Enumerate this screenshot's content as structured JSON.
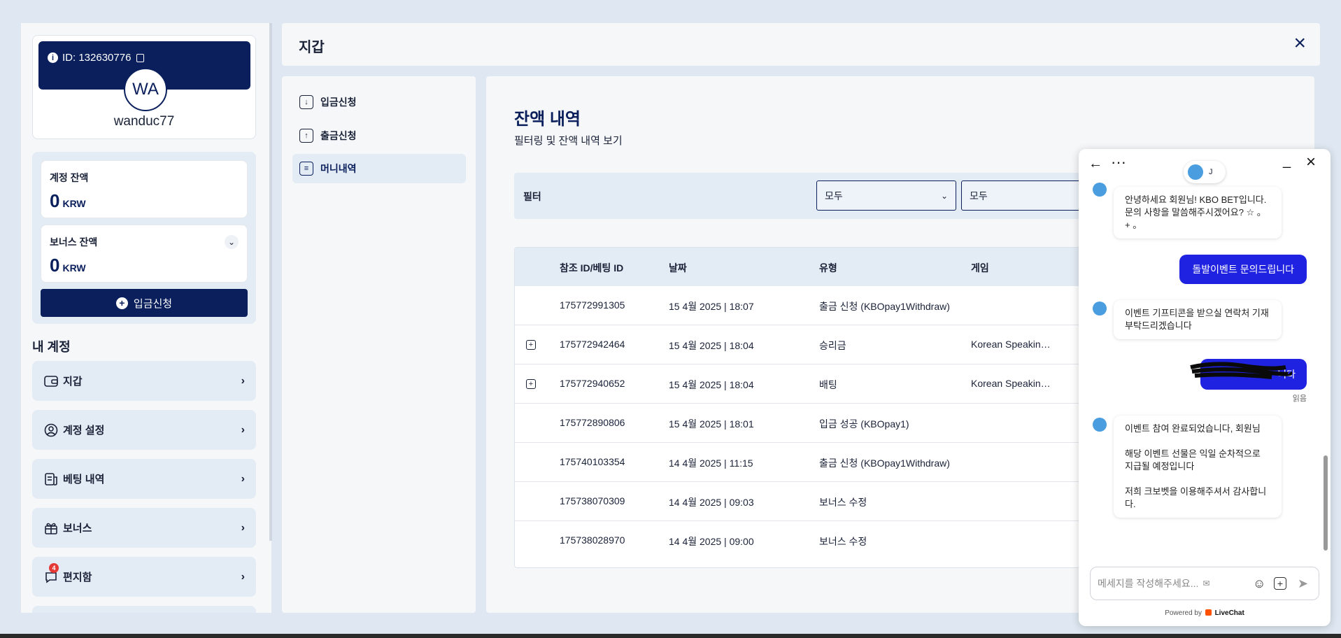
{
  "profile": {
    "id_label": "ID: 132630776",
    "avatar_initials": "WA",
    "username": "wanduc77"
  },
  "balances": {
    "account": {
      "label": "계정 잔액",
      "value": "0",
      "currency": "KRW"
    },
    "bonus": {
      "label": "보너스 잔액",
      "value": "0",
      "currency": "KRW"
    },
    "deposit_button": "입금신청"
  },
  "my_account": {
    "title": "내 계정",
    "items": [
      {
        "label": "지갑",
        "icon": "wallet-icon"
      },
      {
        "label": "계정 설정",
        "icon": "user-icon"
      },
      {
        "label": "베팅 내역",
        "icon": "receipt-icon"
      },
      {
        "label": "보너스",
        "icon": "gift-icon"
      },
      {
        "label": "편지함",
        "icon": "chat-bubble-icon",
        "badge": "4"
      }
    ]
  },
  "wallet": {
    "title": "지갑",
    "menu": [
      {
        "label": "입금신청",
        "icon": "download-icon"
      },
      {
        "label": "출금신청",
        "icon": "upload-icon"
      },
      {
        "label": "머니내역",
        "icon": "document-icon",
        "active": true
      }
    ]
  },
  "history": {
    "title": "잔액 내역",
    "subtitle": "필터링 및 잔액 내역 보기",
    "filter_label": "필터",
    "filter_values": [
      "모두",
      "모두"
    ],
    "columns": [
      "참조 ID/베팅 ID",
      "날짜",
      "유형",
      "게임"
    ],
    "rows": [
      {
        "id": "175772991305",
        "date": "15 4월 2025 | 18:07",
        "type": "출금 신청 (KBOpay1Withdraw)",
        "game": "",
        "expandable": false
      },
      {
        "id": "175772942464",
        "date": "15 4월 2025 | 18:04",
        "type": "승리금",
        "game": "Korean Speakin…",
        "expandable": true
      },
      {
        "id": "175772940652",
        "date": "15 4월 2025 | 18:04",
        "type": "배팅",
        "game": "Korean Speakin…",
        "expandable": true
      },
      {
        "id": "175772890806",
        "date": "15 4월 2025 | 18:01",
        "type": "입금 성공 (KBOpay1)",
        "game": "",
        "expandable": false
      },
      {
        "id": "175740103354",
        "date": "14 4월 2025 | 11:15",
        "type": "출금 신청 (KBOpay1Withdraw)",
        "game": "",
        "expandable": false
      },
      {
        "id": "175738070309",
        "date": "14 4월 2025 | 09:03",
        "type": "보너스 수정",
        "game": "",
        "expandable": false
      },
      {
        "id": "175738028970",
        "date": "14 4월 2025 | 09:00",
        "type": "보너스 수정",
        "game": "",
        "expandable": false
      }
    ]
  },
  "chat": {
    "agent_initial": "J",
    "messages": [
      {
        "from": "agent",
        "text": "안녕하세요 회원님! KBO BET입니다. 문의 사항을 말씀해주시겠어요? ☆ 。 + 。"
      },
      {
        "from": "user",
        "text": "돌발이벤트 문의드립니다"
      },
      {
        "from": "agent",
        "text": "이벤트 기프티콘을 받으실 연락처 기재 부탁드리겠습니다"
      },
      {
        "from": "user",
        "text": "니다",
        "redacted": true
      },
      {
        "from": "agent",
        "text": "이벤트 참여 완료되었습니다, 회원님\n\n해당 이벤트 선물은 익일 순차적으로 지급될 예정입니다\n\n저희 크보벳을 이용해주셔서 감사합니다."
      }
    ],
    "read_receipt": "읽음",
    "input_placeholder": "메세지를 작성해주세요...",
    "powered_by": "Powered by",
    "brand": "LiveChat"
  },
  "colors": {
    "navy": "#0a1f5c",
    "panel": "#f6f7f9",
    "light_blue": "#e3ebf4",
    "chat_blue": "#1f22e0"
  }
}
